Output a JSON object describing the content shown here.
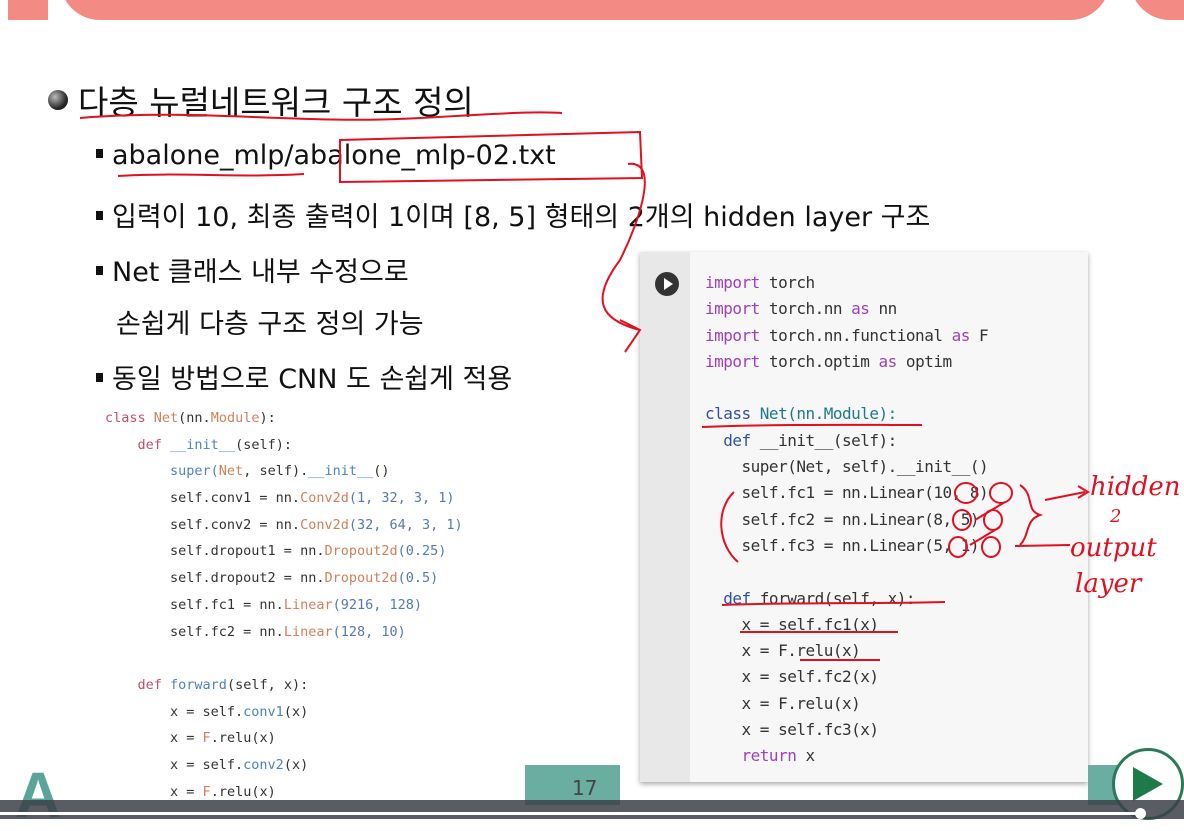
{
  "slide": {
    "title": "다층 뉴럴네트워크 구조 정의",
    "bullets": [
      {
        "path_dir": "abalone_mlp/",
        "path_file": "abalone_mlp-02.txt"
      },
      {
        "text": "입력이 10, 최종 출력이 1이며 [8, 5] 형태의 2개의 hidden layer 구조"
      },
      {
        "text": "Net 클래스 내부 수정으로",
        "cont": "손쉽게 다층 구조 정의 가능"
      },
      {
        "text": "동일 방법으로 CNN 도 손쉽게 적용"
      }
    ],
    "page_number": "17"
  },
  "left_code": [
    [
      [
        "class ",
        "k"
      ],
      [
        "Net",
        "cls"
      ],
      [
        "(nn.",
        "id"
      ],
      [
        "Module",
        "cls"
      ],
      [
        "):",
        "id"
      ]
    ],
    [
      [
        "    def ",
        "k"
      ],
      [
        "__init__",
        "fn"
      ],
      [
        "(self):",
        "id"
      ]
    ],
    [
      [
        "        super(",
        "fn"
      ],
      [
        "Net",
        "cls"
      ],
      [
        ", self).",
        "id"
      ],
      [
        "__init__",
        "fn"
      ],
      [
        "()",
        "id"
      ]
    ],
    [
      [
        "        self.conv1 = nn.",
        "id"
      ],
      [
        "Conv2d",
        "cls"
      ],
      [
        "(1, 32, 3, 1)",
        "num"
      ]
    ],
    [
      [
        "        self.conv2 = nn.",
        "id"
      ],
      [
        "Conv2d",
        "cls"
      ],
      [
        "(32, 64, 3, 1)",
        "num"
      ]
    ],
    [
      [
        "        self.dropout1 = nn.",
        "id"
      ],
      [
        "Dropout2d",
        "cls"
      ],
      [
        "(0.25)",
        "num"
      ]
    ],
    [
      [
        "        self.dropout2 = nn.",
        "id"
      ],
      [
        "Dropout2d",
        "cls"
      ],
      [
        "(0.5)",
        "num"
      ]
    ],
    [
      [
        "        self.fc1 = nn.",
        "id"
      ],
      [
        "Linear",
        "cls"
      ],
      [
        "(9216, 128)",
        "num"
      ]
    ],
    [
      [
        "        self.fc2 = nn.",
        "id"
      ],
      [
        "Linear",
        "cls"
      ],
      [
        "(128, 10)",
        "num"
      ]
    ],
    [
      [
        "",
        "id"
      ]
    ],
    [
      [
        "    def ",
        "k"
      ],
      [
        "forward",
        "fn"
      ],
      [
        "(self, x):",
        "id"
      ]
    ],
    [
      [
        "        x = self.",
        "id"
      ],
      [
        "conv1",
        "fn"
      ],
      [
        "(x)",
        "id"
      ]
    ],
    [
      [
        "        x = ",
        "id"
      ],
      [
        "F",
        "cls"
      ],
      [
        ".relu(x)",
        "id"
      ]
    ],
    [
      [
        "        x = self.",
        "id"
      ],
      [
        "conv2",
        "fn"
      ],
      [
        "(x)",
        "id"
      ]
    ],
    [
      [
        "        x = ",
        "id"
      ],
      [
        "F",
        "cls"
      ],
      [
        ".relu(x)",
        "id"
      ]
    ]
  ],
  "right_code": [
    [
      [
        "import",
        "rk"
      ],
      [
        " torch",
        "id"
      ]
    ],
    [
      [
        "import",
        "rk"
      ],
      [
        " torch.nn ",
        "id"
      ],
      [
        "as",
        "rk"
      ],
      [
        " nn",
        "id"
      ]
    ],
    [
      [
        "import",
        "rk"
      ],
      [
        " torch.nn.functional ",
        "id"
      ],
      [
        "as",
        "rk"
      ],
      [
        " F",
        "id"
      ]
    ],
    [
      [
        "import",
        "rk"
      ],
      [
        " torch.optim ",
        "id"
      ],
      [
        "as",
        "rk"
      ],
      [
        " optim",
        "id"
      ]
    ],
    [
      [
        "",
        "id"
      ]
    ],
    [
      [
        "class ",
        "rd"
      ],
      [
        "Net(nn.Module):",
        "rc"
      ]
    ],
    [
      [
        "  def ",
        "rd"
      ],
      [
        "__init__(self):",
        "id"
      ]
    ],
    [
      [
        "    super(Net, self).__init__()",
        "id"
      ]
    ],
    [
      [
        "    self.fc1 = nn.Linear(10, 8)",
        "id"
      ]
    ],
    [
      [
        "    self.fc2 = nn.Linear(8, 5)",
        "id"
      ]
    ],
    [
      [
        "    self.fc3 = nn.Linear(5, 1)",
        "id"
      ]
    ],
    [
      [
        "",
        "id"
      ]
    ],
    [
      [
        "  def ",
        "rd"
      ],
      [
        "forward(self, x):",
        "id"
      ]
    ],
    [
      [
        "    x = self.fc1(x)",
        "id"
      ]
    ],
    [
      [
        "    x = F.relu(x)",
        "id"
      ]
    ],
    [
      [
        "    x = self.fc2(x)",
        "id"
      ]
    ],
    [
      [
        "    x = F.relu(x)",
        "id"
      ]
    ],
    [
      [
        "    x = self.fc3(x)",
        "id"
      ]
    ],
    [
      [
        "    return",
        "rk"
      ],
      [
        " x",
        "id"
      ]
    ]
  ],
  "annotations": {
    "hidden": "hidden",
    "hidden_count": "2",
    "output": "output",
    "layer": "layer"
  },
  "video": {
    "progress": 0.963
  },
  "colors": {
    "banner": "#f48a84",
    "accent_teal": "#6aaea2",
    "ink": "#e01020"
  }
}
